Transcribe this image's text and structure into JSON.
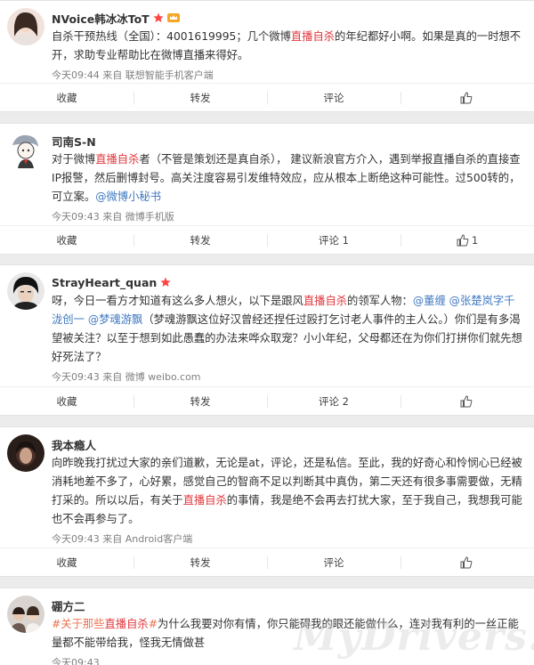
{
  "posts": [
    {
      "user": "NVoice韩冰冰ToT",
      "avatar": "avatar-girl",
      "text": [
        {
          "t": "自杀干预热线（全国）：4001619995；几个微博"
        },
        {
          "t": "直播自杀",
          "c": "hl"
        },
        {
          "t": "的年纪都好小啊。如果是真的一时想不开，求助专业帮助比在微博直播来得好。"
        }
      ],
      "meta": "今天09:44 来自 联想智能手机客户端",
      "actions": {
        "fav": "收藏",
        "repost": "转发",
        "comment": "评论",
        "like": ""
      }
    },
    {
      "user": "司南S-N",
      "avatar": "avatar-cartoon",
      "text": [
        {
          "t": "对于微博"
        },
        {
          "t": "直播自杀",
          "c": "hl"
        },
        {
          "t": "者（不管是策划还是真自杀），  建议新浪官方介入，遇到举报直播自杀的直接查IP报警，然后删博封号。高关注度容易引发维特效应，应从根本上断绝这种可能性。过500转的，可立案。"
        },
        {
          "t": "@微博小秘书",
          "c": "at"
        }
      ],
      "meta": "今天09:43 来自 微博手机版",
      "actions": {
        "fav": "收藏",
        "repost": "转发",
        "comment": "评论 1",
        "like": "1"
      }
    },
    {
      "user": "StrayHeart_quan",
      "avatar": "avatar-boy",
      "text": [
        {
          "t": "呀，今日一看方才知道有这么多人想火，以下是跟风"
        },
        {
          "t": "直播自杀",
          "c": "hl"
        },
        {
          "t": "的领军人物："
        },
        {
          "t": "@董缠",
          "c": "at"
        },
        {
          "t": " "
        },
        {
          "t": "@张楚岚字千泷创一",
          "c": "at"
        },
        {
          "t": " "
        },
        {
          "t": "@梦魂游飘",
          "c": "at"
        },
        {
          "t": "（梦魂游飘这位好汉曾经还捏任过殴打乞讨老人事件的主人公。）你们是有多渴望被关注？以至于想到如此愚蠢的办法来哗众取宠？小小年纪，父母都还在为你们打拼你们就先想好死法了？"
        }
      ],
      "meta": "今天09:43 来自 微博 weibo.com",
      "actions": {
        "fav": "收藏",
        "repost": "转发",
        "comment": "评论 2",
        "like": ""
      }
    },
    {
      "user": "我本瘾人",
      "avatar": "avatar-dark",
      "text": [
        {
          "t": "向昨晚我打扰过大家的亲们道歉，无论是at，评论，还是私信。至此，我的好奇心和怜悯心已经被消耗地差不多了，心好累，感觉自己的智商不足以判断其中真伪，第二天还有很多事需要做，无精打采的。所以以后，有关于"
        },
        {
          "t": "直播自杀",
          "c": "hl"
        },
        {
          "t": "的事情，我是绝不会再去打扰大家，至于我自己，我想我可能也不会再参与了。"
        }
      ],
      "meta": "今天09:43 来自 Android客户端",
      "actions": {
        "fav": "收藏",
        "repost": "转发",
        "comment": "评论",
        "like": ""
      }
    },
    {
      "user": "硼方二",
      "avatar": "avatar-group",
      "text": [
        {
          "t": "#关于那些",
          "c": "link"
        },
        {
          "t": "直播自杀",
          "c": "hl"
        },
        {
          "t": "#",
          "c": "link"
        },
        {
          "t": "为什么我要对你有情，你只能碍我的眼还能做什么，连对我有利的一丝正能量都不能带给我，怪我无情做甚"
        }
      ],
      "meta": "今天09:43",
      "actions": null
    }
  ],
  "watermark": "MyDrivers.com",
  "colors": {
    "highlight": "#e0383e",
    "mention": "#3f78c0",
    "topic": "#eb7350"
  }
}
